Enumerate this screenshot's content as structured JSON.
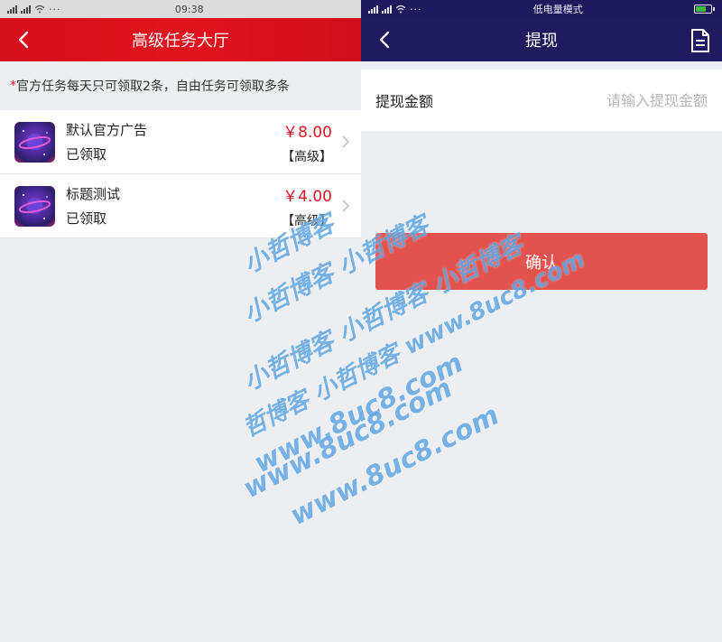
{
  "left": {
    "status": {
      "time": "09:38",
      "dots": "···"
    },
    "header": {
      "title": "高级任务大厅"
    },
    "notice": {
      "star": "*",
      "text": "官方任务每天只可领取2条，自由任务可领取多条"
    },
    "tasks": [
      {
        "title": "默认官方广告",
        "status": "已领取",
        "price": "￥8.00",
        "level": "【高级】"
      },
      {
        "title": "标题测试",
        "status": "已领取",
        "price": "￥4.00",
        "level": "【高级】"
      }
    ]
  },
  "right": {
    "status": {
      "mode": "低电量模式"
    },
    "header": {
      "title": "提现"
    },
    "form": {
      "label": "提现金额",
      "placeholder": "请输入提现金额",
      "value": ""
    },
    "confirm_label": "确认"
  },
  "watermark": {
    "lines": [
      "小哲博客",
      "小哲博客 小哲博客",
      "小哲博客 小哲博客 小哲博客",
      "哲博客 小哲博客 www.8uc8.com",
      "www.8uc8.com",
      "www.8uc8.com",
      "www.8uc8.com"
    ]
  },
  "colors": {
    "header_red": "#e1141e",
    "header_indigo": "#201b5f",
    "price": "#e0141e",
    "confirm": "#e2534f",
    "watermark": "#4296dc"
  }
}
